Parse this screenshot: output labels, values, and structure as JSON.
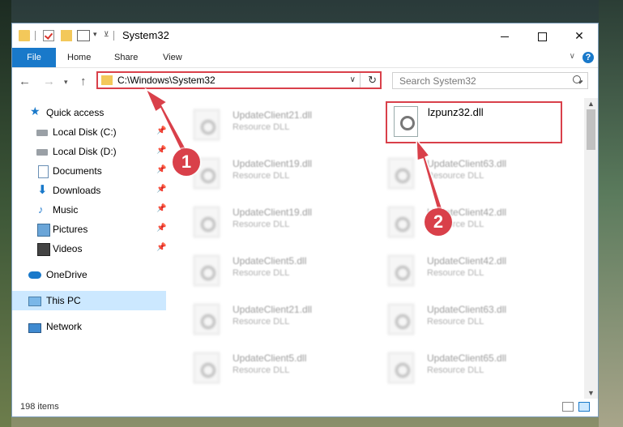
{
  "window": {
    "title": "System32",
    "controls": {
      "minimize": "",
      "maximize": "",
      "close": "✕"
    }
  },
  "ribbon": {
    "tabs": [
      {
        "label": "File"
      },
      {
        "label": "Home"
      },
      {
        "label": "Share"
      },
      {
        "label": "View"
      }
    ],
    "help": "?"
  },
  "navbar": {
    "address": "C:\\Windows\\System32",
    "search_placeholder": "Search System32"
  },
  "sidebar": {
    "items": [
      {
        "label": "Quick access",
        "icon": "star-icon",
        "pinned": false
      },
      {
        "label": "Local Disk (C:)",
        "icon": "drive-icon",
        "pinned": true
      },
      {
        "label": "Local Disk (D:)",
        "icon": "drive-icon",
        "pinned": true
      },
      {
        "label": "Documents",
        "icon": "documents-icon",
        "pinned": true
      },
      {
        "label": "Downloads",
        "icon": "download-icon",
        "pinned": true
      },
      {
        "label": "Music",
        "icon": "music-icon",
        "pinned": true
      },
      {
        "label": "Pictures",
        "icon": "pictures-icon",
        "pinned": true
      },
      {
        "label": "Videos",
        "icon": "videos-icon",
        "pinned": true
      },
      {
        "label": "OneDrive",
        "icon": "cloud-icon",
        "pinned": false
      },
      {
        "label": "This PC",
        "icon": "computer-icon",
        "pinned": false,
        "selected": true
      },
      {
        "label": "Network",
        "icon": "network-icon",
        "pinned": false
      }
    ]
  },
  "files": {
    "left_column": [
      {
        "name": "UpdateClient21.dll",
        "type": "Resource DLL"
      },
      {
        "name": "UpdateClient19.dll",
        "type": "Resource DLL"
      },
      {
        "name": "UpdateClient19.dll",
        "type": "Resource DLL"
      },
      {
        "name": "UpdateClient5.dll",
        "type": "Resource DLL"
      },
      {
        "name": "UpdateClient21.dll",
        "type": "Resource DLL"
      },
      {
        "name": "UpdateClient5.dll",
        "type": "Resource DLL"
      }
    ],
    "right_column": [
      {
        "name": "UpdateClient63.dll",
        "type": "Resource DLL"
      },
      {
        "name": "UpdateClient42.dll",
        "type": "Resource DLL"
      },
      {
        "name": "UpdateClient42.dll",
        "type": "Resource DLL"
      },
      {
        "name": "UpdateClient63.dll",
        "type": "Resource DLL"
      },
      {
        "name": "UpdateClient65.dll",
        "type": "Resource DLL"
      }
    ],
    "highlighted": {
      "name": "lzpunz32.dll"
    }
  },
  "status": {
    "item_count": "198 items"
  },
  "annotations": {
    "step1": "1",
    "step2": "2",
    "color": "#d9404a"
  }
}
